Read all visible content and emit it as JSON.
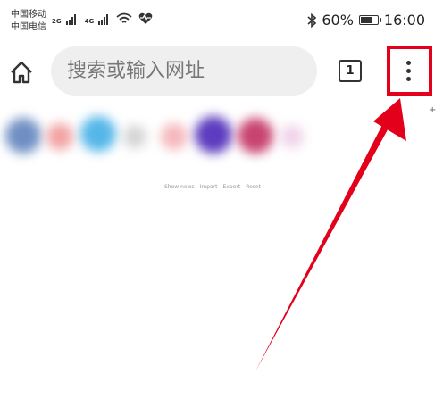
{
  "status_bar": {
    "carrier_1": "中国移动",
    "carrier_2": "中国电信",
    "net_1": "2G",
    "net_2": "4G",
    "battery": "60%",
    "time": "16:00"
  },
  "toolbar": {
    "search_placeholder": "搜索或输入网址",
    "tab_count": "1"
  },
  "new_tab_page": {
    "add_symbol": "+",
    "links": [
      "Show news",
      "Import",
      "Export",
      "Reset"
    ]
  },
  "colors": {
    "highlight": "#e3001b",
    "arrow": "#e3001b",
    "omnibox_bg": "#efefef"
  }
}
